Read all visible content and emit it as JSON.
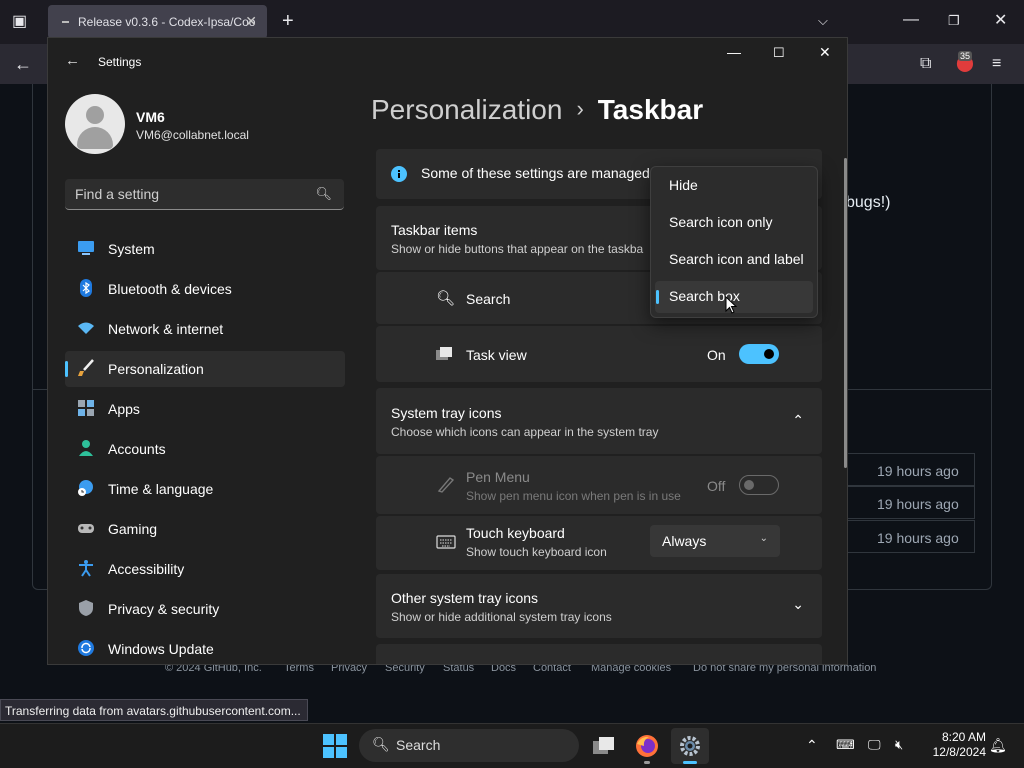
{
  "browser": {
    "tab_title": "Release v0.3.6 - Codex-Ipsa/Coo",
    "status_text": "Transferring data from avatars.githubusercontent.com...",
    "extension_badge": "35",
    "page_text": "bugs!)",
    "times": [
      "19 hours ago",
      "19 hours ago",
      "19 hours ago"
    ],
    "footer": {
      "copyright": "© 2024 GitHub, Inc.",
      "links": [
        "Terms",
        "Privacy",
        "Security",
        "Status",
        "Docs",
        "Contact",
        "Manage cookies",
        "Do not share my personal information"
      ]
    }
  },
  "settings": {
    "window_title": "Settings",
    "user": {
      "name": "VM6",
      "email": "VM6@collabnet.local"
    },
    "search_placeholder": "Find a setting",
    "nav": [
      {
        "label": "System",
        "icon": "monitor-icon"
      },
      {
        "label": "Bluetooth & devices",
        "icon": "bluetooth-icon"
      },
      {
        "label": "Network & internet",
        "icon": "wifi-icon"
      },
      {
        "label": "Personalization",
        "icon": "brush-icon",
        "active": true
      },
      {
        "label": "Apps",
        "icon": "apps-icon"
      },
      {
        "label": "Accounts",
        "icon": "person-icon"
      },
      {
        "label": "Time & language",
        "icon": "globe-clock-icon"
      },
      {
        "label": "Gaming",
        "icon": "gamepad-icon"
      },
      {
        "label": "Accessibility",
        "icon": "accessibility-icon"
      },
      {
        "label": "Privacy & security",
        "icon": "shield-icon"
      },
      {
        "label": "Windows Update",
        "icon": "update-icon"
      }
    ],
    "breadcrumb": {
      "parent": "Personalization",
      "current": "Taskbar"
    },
    "info_banner": "Some of these settings are managed",
    "taskbar_items": {
      "title": "Taskbar items",
      "subtitle": "Show or hide buttons that appear on the taskba",
      "search_label": "Search",
      "task_view_label": "Task view",
      "task_view_state": "On"
    },
    "system_tray": {
      "title": "System tray icons",
      "subtitle": "Choose which icons can appear in the system tray",
      "pen_menu": {
        "label": "Pen Menu",
        "subtitle": "Show pen menu icon when pen is in use",
        "state": "Off"
      },
      "touch_keyboard": {
        "label": "Touch keyboard",
        "subtitle": "Show touch keyboard icon",
        "value": "Always"
      }
    },
    "other_tray": {
      "title": "Other system tray icons",
      "subtitle": "Show or hide additional system tray icons"
    },
    "search_dropdown": {
      "options": [
        "Hide",
        "Search icon only",
        "Search icon and label",
        "Search box"
      ],
      "selected": "Search box"
    },
    "accent_color": "#4cc2ff"
  },
  "taskbar": {
    "search_label": "Search",
    "time": "8:20 AM",
    "date": "12/8/2024"
  }
}
